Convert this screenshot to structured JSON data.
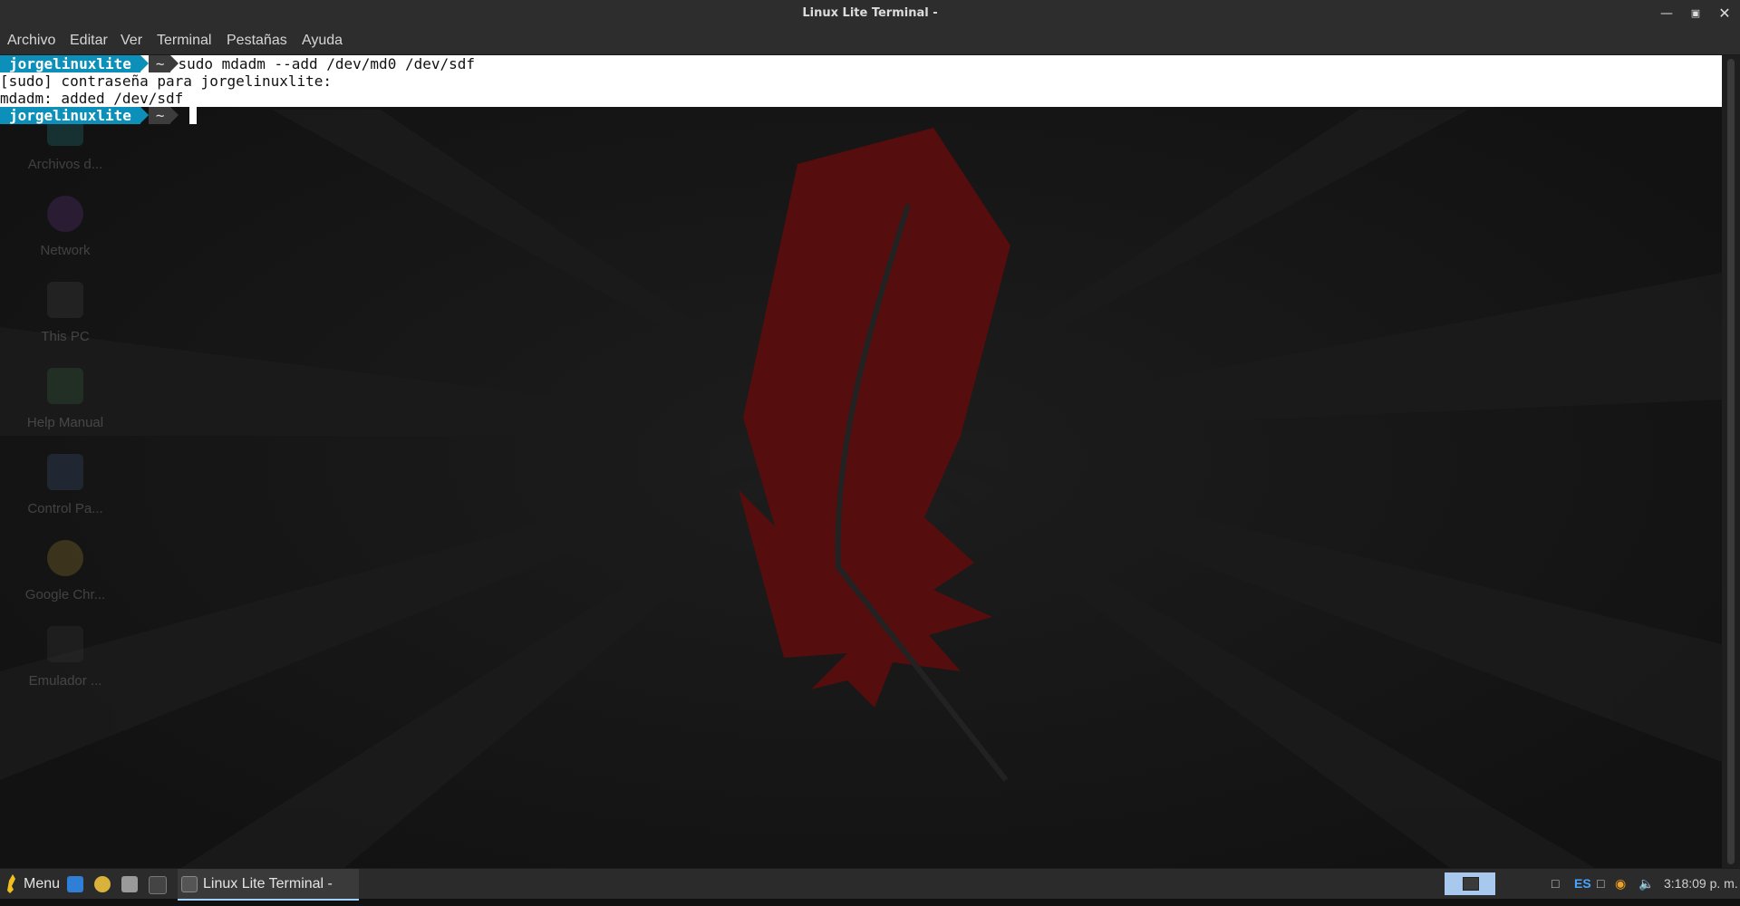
{
  "window": {
    "title": "Linux Lite Terminal -"
  },
  "menubar": {
    "items": [
      "Archivo",
      "Editar",
      "Ver",
      "Terminal",
      "Pestañas",
      "Ayuda"
    ]
  },
  "terminal": {
    "prompt_user": "jorgelinuxlite",
    "prompt_dir": "~",
    "command": "sudo mdadm --add /dev/md0 /dev/sdf",
    "output": [
      "[sudo] contraseña para jorgelinuxlite:",
      "mdadm: added /dev/sdf"
    ]
  },
  "desktop": {
    "icons": [
      {
        "label": "Archivos d...",
        "icon": "home-folder-icon"
      },
      {
        "label": "Network",
        "icon": "network-globe-icon"
      },
      {
        "label": "This PC",
        "icon": "computer-icon"
      },
      {
        "label": "Help Manual",
        "icon": "help-manual-icon"
      },
      {
        "label": "Control Pa...",
        "icon": "control-panel-icon"
      },
      {
        "label": "Google Chr...",
        "icon": "chrome-icon"
      },
      {
        "label": "Emulador ...",
        "icon": "terminal-emulator-icon"
      }
    ]
  },
  "taskbar": {
    "menu_label": "Menu",
    "active_task": "Linux Lite Terminal -",
    "keyboard_layout": "ES",
    "clock": "3:18:09 p. m."
  },
  "colors": {
    "prompt_user_bg": "#0c8fb8",
    "wallpaper_feather": "#5a0d0d",
    "titlebar_bg": "#2d2d2d"
  }
}
